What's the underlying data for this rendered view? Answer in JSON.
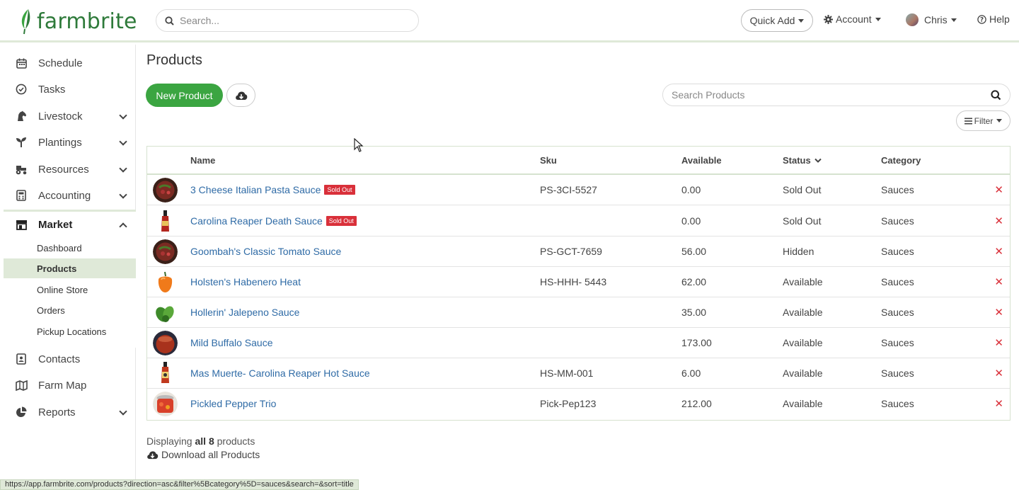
{
  "header": {
    "brand": "farmbrite",
    "search_placeholder": "Search...",
    "quick_add": "Quick Add",
    "account": "Account",
    "user": "Chris",
    "help": "Help"
  },
  "sidebar": {
    "items": [
      {
        "label": "Schedule",
        "icon": "calendar-icon"
      },
      {
        "label": "Tasks",
        "icon": "check-circle-icon"
      },
      {
        "label": "Livestock",
        "icon": "horse-icon"
      },
      {
        "label": "Plantings",
        "icon": "seedling-icon"
      },
      {
        "label": "Resources",
        "icon": "tractor-icon"
      },
      {
        "label": "Accounting",
        "icon": "calculator-icon"
      },
      {
        "label": "Market",
        "icon": "store-icon"
      },
      {
        "label": "Contacts",
        "icon": "address-book-icon"
      },
      {
        "label": "Farm Map",
        "icon": "map-icon"
      },
      {
        "label": "Reports",
        "icon": "pie-chart-icon"
      }
    ],
    "market_sub": [
      "Dashboard",
      "Products",
      "Online Store",
      "Orders",
      "Pickup Locations"
    ]
  },
  "main": {
    "title": "Products",
    "new_product": "New Product",
    "search_placeholder": "Search Products",
    "filter": "Filter",
    "columns": [
      "Name",
      "Sku",
      "Available",
      "Status",
      "Category"
    ],
    "rows": [
      {
        "name": "3 Cheese Italian Pasta Sauce",
        "badge": "Sold Out",
        "sku": "PS-3CI-5527",
        "available": "0.00",
        "status": "Sold Out",
        "category": "Sauces"
      },
      {
        "name": "Carolina Reaper Death Sauce",
        "badge": "Sold Out",
        "sku": "",
        "available": "0.00",
        "status": "Sold Out",
        "category": "Sauces"
      },
      {
        "name": "Goombah's Classic Tomato Sauce",
        "badge": "",
        "sku": "PS-GCT-7659",
        "available": "56.00",
        "status": "Hidden",
        "category": "Sauces"
      },
      {
        "name": "Holsten's Habenero Heat",
        "badge": "",
        "sku": "HS-HHH- 5443",
        "available": "62.00",
        "status": "Available",
        "category": "Sauces"
      },
      {
        "name": "Hollerin' Jalepeno Sauce",
        "badge": "",
        "sku": "",
        "available": "35.00",
        "status": "Available",
        "category": "Sauces"
      },
      {
        "name": "Mild Buffalo Sauce",
        "badge": "",
        "sku": "",
        "available": "173.00",
        "status": "Available",
        "category": "Sauces"
      },
      {
        "name": "Mas Muerte- Carolina Reaper Hot Sauce",
        "badge": "",
        "sku": "HS-MM-001",
        "available": "6.00",
        "status": "Available",
        "category": "Sauces"
      },
      {
        "name": "Pickled Pepper Trio",
        "badge": "",
        "sku": "Pick-Pep123",
        "available": "212.00",
        "status": "Available",
        "category": "Sauces"
      }
    ],
    "displaying_prefix": "Displaying",
    "displaying_all": "all 8",
    "displaying_suffix": "products",
    "download_all": "Download all Products"
  },
  "status_url": "https://app.farmbrite.com/products?direction=asc&filter%5Bcategory%5D=sauces&search=&sort=title",
  "colors": {
    "brand_green": "#3ba541",
    "link_blue": "#2f6ba6",
    "danger_red": "#d9303a",
    "accent_light": "#dfe9d8"
  }
}
